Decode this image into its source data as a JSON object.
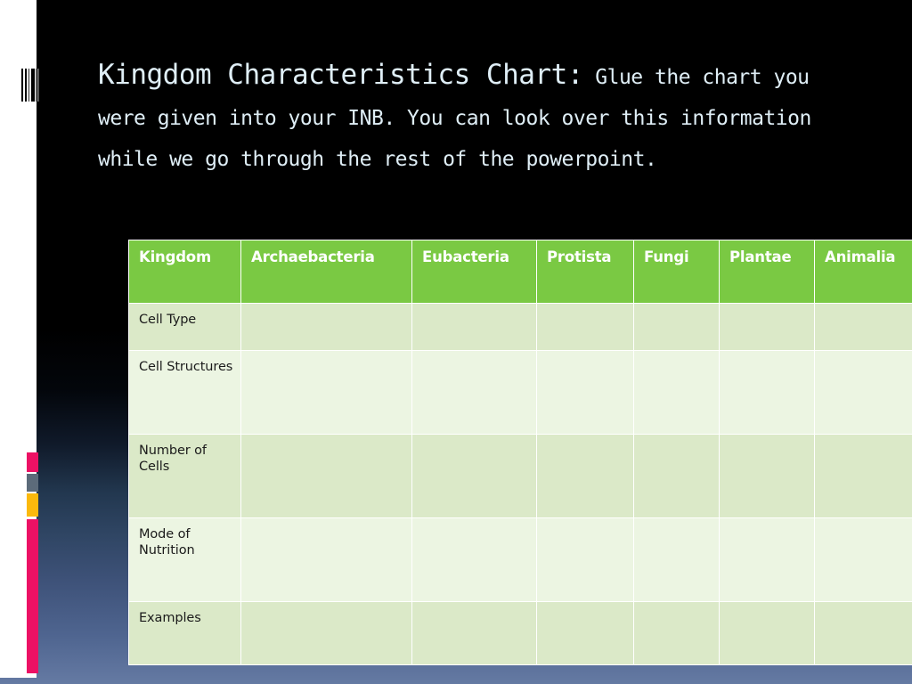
{
  "slide": {
    "title_main": "Kingdom Characteristics Chart:",
    "title_sub": " Glue the chart you were given into your INB. You can look over this information while we go through the rest of the powerpoint.",
    "background_top_color": "#000000",
    "background_bottom_color": "#657aa3",
    "accent_green": "#7ac943",
    "accent_pink": "#ec1164",
    "accent_yellow": "#fbb90c",
    "accent_gray": "#5c6b7a"
  },
  "table": {
    "headers": [
      "Kingdom",
      "Archaebacteria",
      "Eubacteria",
      "Protista",
      "Fungi",
      "Plantae",
      "Animalia"
    ],
    "rows": [
      {
        "label": "Cell Type",
        "cells": [
          "",
          "",
          "",
          "",
          "",
          ""
        ]
      },
      {
        "label": "Cell Structures",
        "cells": [
          "",
          "",
          "",
          "",
          "",
          ""
        ]
      },
      {
        "label": "Number of Cells",
        "cells": [
          "",
          "",
          "",
          "",
          "",
          ""
        ]
      },
      {
        "label": "Mode of Nutrition",
        "cells": [
          "",
          "",
          "",
          "",
          "",
          ""
        ]
      },
      {
        "label": "Examples",
        "cells": [
          "",
          "",
          "",
          "",
          "",
          ""
        ]
      }
    ]
  },
  "decorations": {
    "barcode_label": "barcode-marks",
    "blocks": [
      "pink-small",
      "gray",
      "yellow",
      "pink-long"
    ]
  }
}
